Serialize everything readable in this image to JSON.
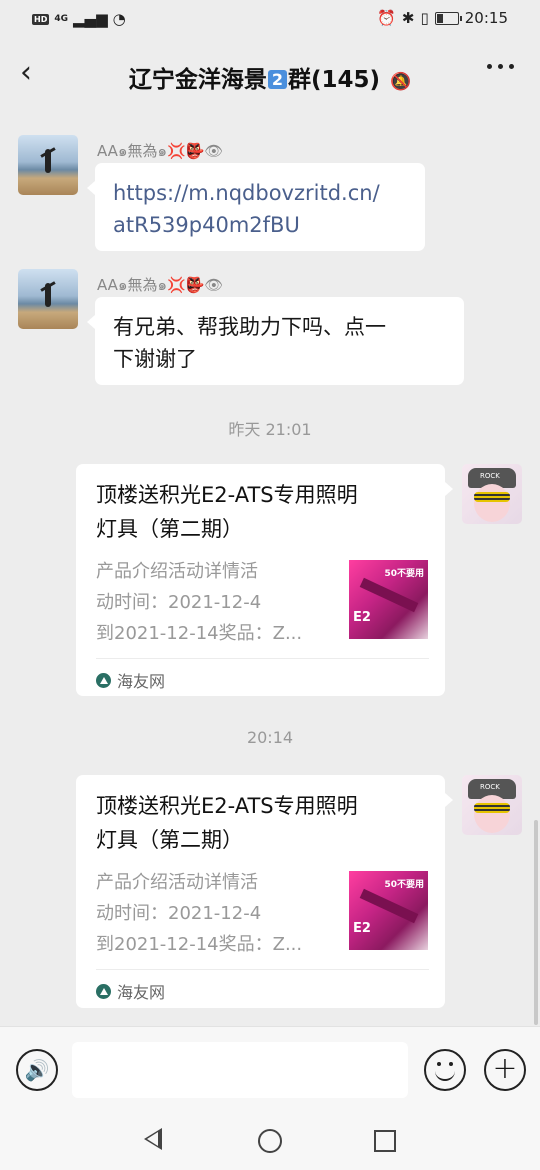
{
  "status_bar": {
    "hd": "HD",
    "network": "4G",
    "time": "20:15",
    "icons": [
      "alarm-icon",
      "bluetooth-icon",
      "vibrate-icon",
      "battery-icon"
    ]
  },
  "header": {
    "title_prefix": "辽宁金洋海景",
    "title_badge": "2",
    "title_suffix": "群(145)",
    "back_icon": "‹",
    "mute_icon": "🔕"
  },
  "messages": [
    {
      "sender": "AA๑無為๑💢👺👁",
      "text": "https://m.nqdbovzritd.cn/atR539p40m2fBU",
      "line1": "https://m.nqdbovzritd.cn/",
      "line2": "atR539p40m2fBU"
    },
    {
      "sender": "AA๑無為๑💢👺👁",
      "line1": "有兄弟、帮我助力下吗、点一",
      "line2": "下谢谢了"
    }
  ],
  "time_separators": [
    "昨天 21:01",
    "20:14"
  ],
  "cards": [
    {
      "title_line1": "顶楼送积光E2-ATS专用照明",
      "title_line2": "灯具（第二期）",
      "desc_line1": "产品介绍活动详情活",
      "desc_line2": "动时间：2021-12-4",
      "desc_line3": "到2021-12-14奖品：Z...",
      "thumb_text_top": "50不要用",
      "thumb_text_bottom": "E2",
      "source": "海友网"
    },
    {
      "title_line1": "顶楼送积光E2-ATS专用照明",
      "title_line2": "灯具（第二期）",
      "desc_line1": "产品介绍活动详情活",
      "desc_line2": "动时间：2021-12-4",
      "desc_line3": "到2021-12-14奖品：Z...",
      "thumb_text_top": "50不要用",
      "thumb_text_bottom": "E2",
      "source": "海友网"
    }
  ],
  "input_bar": {
    "voice_icon": "🔊",
    "plus_icon": "+"
  },
  "colors": {
    "background": "#ededed",
    "bubble": "#ffffff",
    "link": "#4a5f8c",
    "meta_text": "#999999"
  }
}
